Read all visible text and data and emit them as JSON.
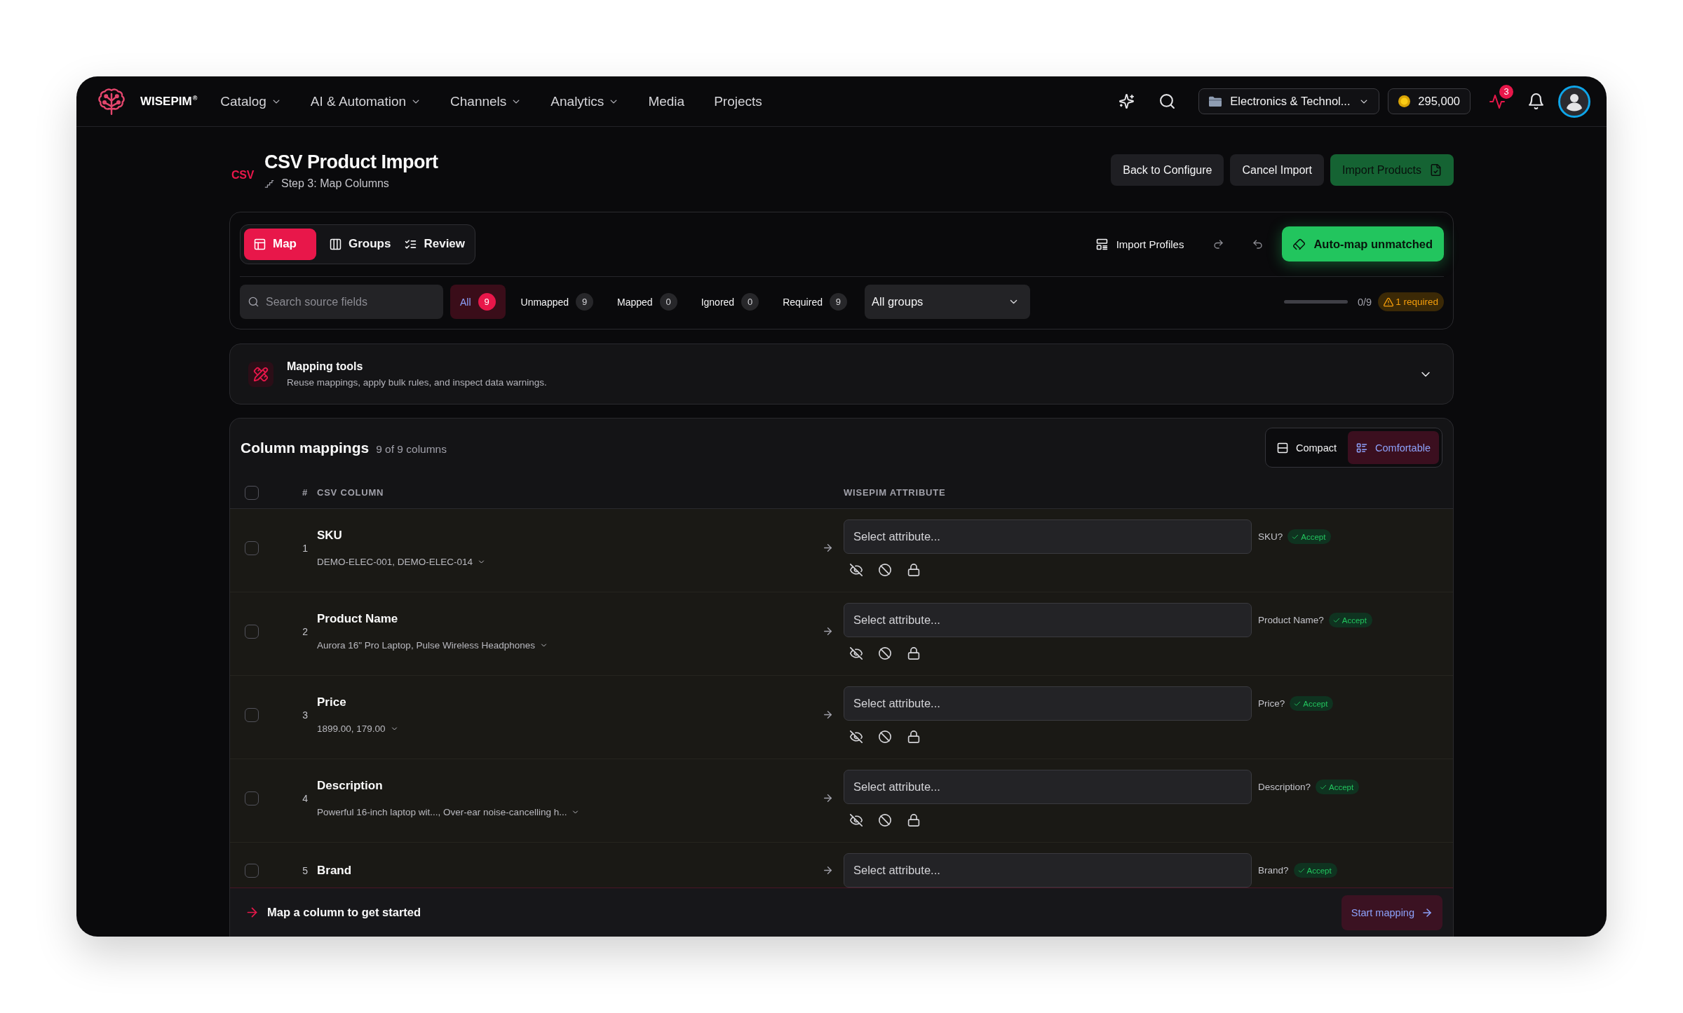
{
  "nav": {
    "brand": "WISEPIM$^{®}$",
    "items": [
      {
        "label": "Catalog",
        "dropdown": true
      },
      {
        "label": "AI & Automation",
        "dropdown": true
      },
      {
        "label": "Channels",
        "dropdown": true
      },
      {
        "label": "Analytics",
        "dropdown": true
      },
      {
        "label": "Media",
        "dropdown": false
      },
      {
        "label": "Projects",
        "dropdown": false
      }
    ],
    "workspace": "Electronics & Technol...",
    "credits": "295,000",
    "activity_count": "3"
  },
  "header": {
    "format_label": "CSV",
    "title": "CSV Product Import",
    "step": "Step 3: Map Columns",
    "buttons": [
      {
        "label": "Back to Configure",
        "kind": "secondary",
        "disabled": false
      },
      {
        "label": "Cancel Import",
        "kind": "secondary",
        "disabled": false
      },
      {
        "label": "Import Products",
        "kind": "primary",
        "disabled": true
      }
    ]
  },
  "toolbar": {
    "tabs": [
      {
        "label": "Map",
        "selected": true
      },
      {
        "label": "Groups",
        "selected": false
      },
      {
        "label": "Review",
        "selected": false
      }
    ],
    "import_profiles": "Import Profiles",
    "auto_map": "Auto-map unmatched",
    "search": {
      "placeholder": "Search source fields"
    },
    "filters": [
      {
        "label": "All",
        "count": "9",
        "selected": true
      },
      {
        "label": "Unmapped",
        "count": "9",
        "selected": false
      },
      {
        "label": "Mapped",
        "count": "0",
        "selected": false
      },
      {
        "label": "Ignored",
        "count": "0",
        "selected": false
      },
      {
        "label": "Required",
        "count": "9",
        "selected": false
      }
    ],
    "group_filter": "All groups",
    "progress": {
      "level": 0,
      "reading": "0/9"
    },
    "required_warning": "1 required"
  },
  "mapping_tools": {
    "title": "Mapping tools",
    "description": "Reuse mappings, apply bulk rules, and inspect data warnings.",
    "expanded": false
  },
  "column_mappings": {
    "title": "Column mappings",
    "count": "9 of 9 columns",
    "density": [
      {
        "label": "Compact",
        "selected": false
      },
      {
        "label": "Comfortable",
        "selected": true
      }
    ],
    "select_all_checked": false,
    "columns": [
      "#",
      "CSV COLUMN",
      "WISEPIM ATTRIBUTE"
    ],
    "rows": [
      {
        "number": "1",
        "name": "SKU",
        "sample": "DEMO-ELEC-001, DEMO-ELEC-014",
        "checked": false,
        "placeholder": "Select attribute...",
        "suggestion": "SKU?",
        "accept_label": "Accept"
      },
      {
        "number": "2",
        "name": "Product Name",
        "sample": "Aurora 16\" Pro Laptop, Pulse Wireless Headphones",
        "checked": false,
        "placeholder": "Select attribute...",
        "suggestion": "Product Name?",
        "accept_label": "Accept"
      },
      {
        "number": "3",
        "name": "Price",
        "sample": "1899.00, 179.00",
        "checked": false,
        "placeholder": "Select attribute...",
        "suggestion": "Price?",
        "accept_label": "Accept"
      },
      {
        "number": "4",
        "name": "Description",
        "sample": "Powerful 16-inch laptop wit..., Over-ear noise-cancelling h...",
        "checked": false,
        "placeholder": "Select attribute...",
        "suggestion": "Description?",
        "accept_label": "Accept"
      },
      {
        "number": "5",
        "name": "Brand",
        "checked": false,
        "placeholder": "Select attribute...",
        "suggestion": "Brand?",
        "accept_label": "Accept"
      }
    ]
  },
  "footer": {
    "message": "Map a column to get started",
    "button": "Start mapping"
  }
}
